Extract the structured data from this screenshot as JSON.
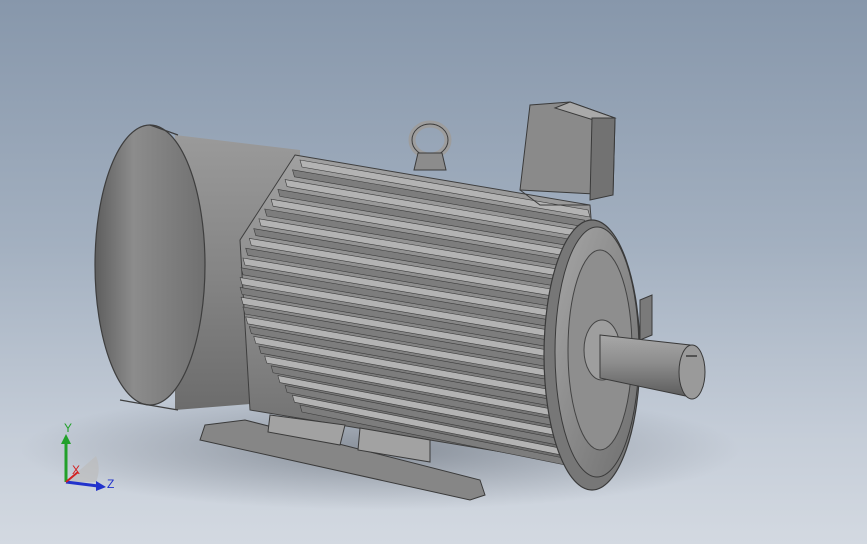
{
  "viewport": {
    "background_top": "#8797ab",
    "background_bottom": "#d3d9e1"
  },
  "model": {
    "body_color": "#8a8a8a",
    "highlight_color": "#bdbdbd",
    "shadow_color": "#4a4a4a"
  },
  "triad": {
    "x_label": "X",
    "y_label": "Y",
    "z_label": "Z",
    "x_color": "#d22222",
    "y_color": "#22a02a",
    "z_color": "#2233cc"
  }
}
